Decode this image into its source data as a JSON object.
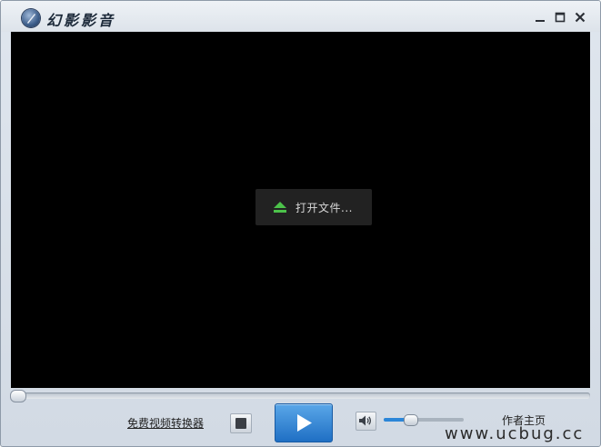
{
  "window": {
    "title": "幻影影音",
    "controls": [
      "minimize-icon",
      "maximize-icon",
      "close-icon"
    ]
  },
  "video": {
    "open_file_label": "打开文件...",
    "open_file_icon": "eject-icon"
  },
  "seek": {
    "progress": 0
  },
  "controls": {
    "converter_link": "免费视频转换器",
    "stop_icon": "stop-icon",
    "play_icon": "play-icon",
    "volume_icon": "speaker-icon",
    "volume_level": 0.33,
    "author_link": "作者主页"
  },
  "watermark": "www.ucbug.cc",
  "colors": {
    "accent": "#2b86d8",
    "play_button": "#3a8fdc",
    "open_icon": "#4cc24a",
    "video_bg": "#000000"
  }
}
